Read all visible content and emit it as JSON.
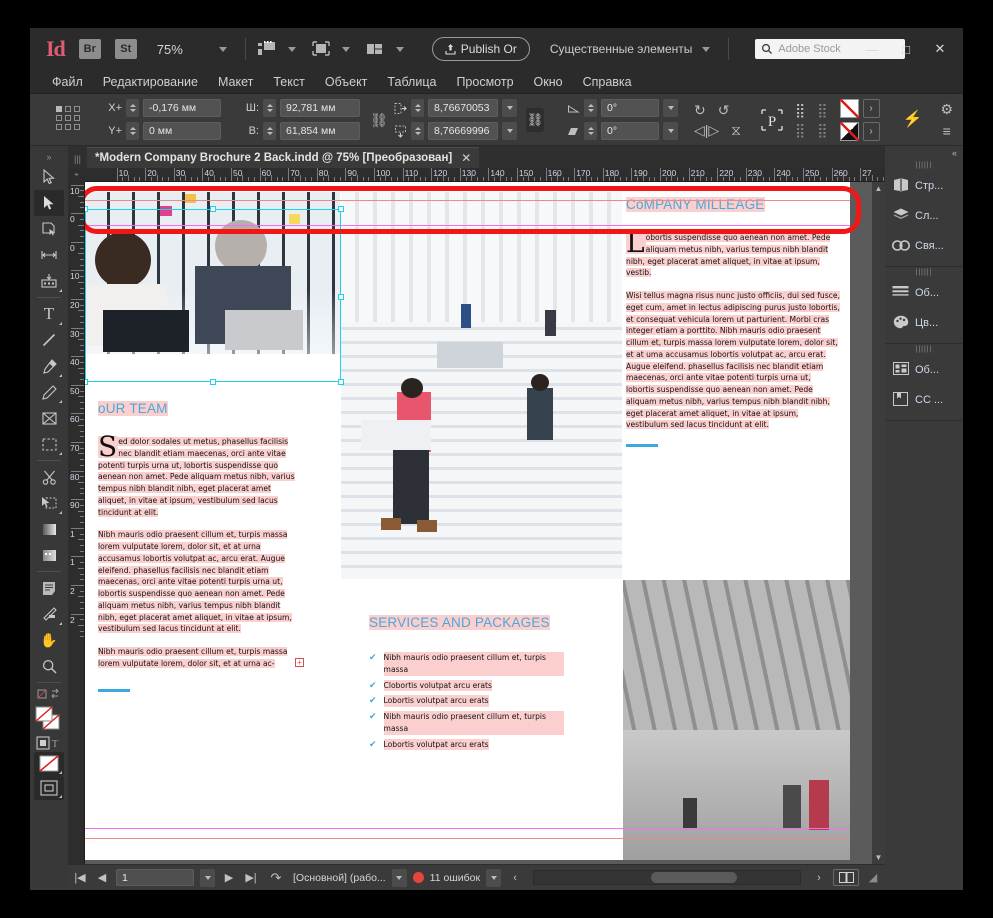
{
  "app": {
    "logo": "Id",
    "bridge_label": "Br",
    "stock_label": "St",
    "zoom_level": "75%",
    "publish_label": "Publish Or",
    "workspace": "Существенные элементы",
    "search_placeholder": "Adobe Stock",
    "win_minimize": "—",
    "win_maximize": "□",
    "win_close": "✕"
  },
  "menu": {
    "items": [
      "Файл",
      "Редактирование",
      "Макет",
      "Текст",
      "Объект",
      "Таблица",
      "Просмотр",
      "Окно",
      "Справка"
    ]
  },
  "control_panel": {
    "x_label": "X+",
    "x_value": "-0,176 мм",
    "y_label": "Y+",
    "y_value": "0 мм",
    "w_label": "Ш:",
    "w_value": "92,781 мм",
    "h_label": "В:",
    "h_value": "61,854 мм",
    "scale_x": "8,76670053",
    "scale_y": "8,76669996",
    "rotate_value": "0°",
    "shear_value": "0°"
  },
  "document": {
    "tab_title": "*Modern Company Brochure 2 Back.indd @ 75% [Преобразован]",
    "tab_close": "✕"
  },
  "rulers": {
    "h_numbers": [
      "10",
      "20",
      "30",
      "40",
      "50",
      "60",
      "70",
      "80",
      "90",
      "100",
      "110",
      "120",
      "130",
      "140",
      "150",
      "160",
      "170",
      "180",
      "190",
      "200",
      "210",
      "220",
      "230",
      "240",
      "250",
      "260",
      "27"
    ],
    "v_numbers": [
      "10",
      "0",
      "0",
      "10",
      "20",
      "30",
      "40",
      "50",
      "60",
      "70",
      "80",
      "90",
      "1",
      "1",
      "2",
      "2"
    ]
  },
  "toolbox": {
    "tools": [
      {
        "name": "selection-tool",
        "glyph": "▷"
      },
      {
        "name": "direct-selection-tool",
        "glyph": "▶"
      },
      {
        "name": "page-tool",
        "glyph": "◫"
      },
      {
        "name": "gap-tool",
        "glyph": "↔"
      },
      {
        "name": "content-collector-tool",
        "glyph": "▤"
      },
      {
        "name": "type-tool",
        "glyph": "T"
      },
      {
        "name": "line-tool",
        "glyph": "／"
      },
      {
        "name": "pen-tool",
        "glyph": "✒"
      },
      {
        "name": "pencil-tool",
        "glyph": "✎"
      },
      {
        "name": "frame-tool",
        "glyph": "⊠"
      },
      {
        "name": "rectangle-tool",
        "glyph": "▢"
      },
      {
        "name": "scissors-tool",
        "glyph": "✂"
      },
      {
        "name": "free-transform-tool",
        "glyph": "⬓"
      },
      {
        "name": "gradient-swatch-tool",
        "glyph": "▨"
      },
      {
        "name": "gradient-feather-tool",
        "glyph": "▩"
      },
      {
        "name": "note-tool",
        "glyph": "▤"
      },
      {
        "name": "eyedropper-tool",
        "glyph": "⌁"
      },
      {
        "name": "hand-tool",
        "glyph": "✋"
      },
      {
        "name": "zoom-tool",
        "glyph": "⚲"
      }
    ]
  },
  "dock": {
    "collapse_glyph": "«",
    "groups": [
      [
        {
          "icon": "pages-icon",
          "label": "Стр...",
          "glyph": "◫"
        },
        {
          "icon": "layers-icon",
          "label": "Сл...",
          "glyph": "◆"
        },
        {
          "icon": "links-icon",
          "label": "Свя...",
          "glyph": "∞"
        }
      ],
      [
        {
          "icon": "stroke-icon",
          "label": "Об...",
          "glyph": "≡"
        },
        {
          "icon": "color-icon",
          "label": "Цв...",
          "glyph": "◒"
        }
      ],
      [
        {
          "icon": "object-styles-icon",
          "label": "Об...",
          "glyph": "▦"
        },
        {
          "icon": "cc-libraries-icon",
          "label": "CC ...",
          "glyph": "❏"
        }
      ]
    ]
  },
  "statusbar": {
    "first_page": "|◀",
    "prev_page": "◀",
    "page_value": "1",
    "next_page": "▶",
    "last_page": "▶|",
    "preflight_label": "[Основной] (рабо...",
    "errors_label": "11 ошибок",
    "more_glyph": "‹",
    "expand_glyph": "›"
  },
  "brochure": {
    "company_heading": "CoMPANY MILLEAGE",
    "company_dropcap": "L",
    "company_p1": "obortis suspendisse quo aenean non amet. Pede aliquam metus nibh, varius tempus nibh blandit nibh, eget placerat amet aliquet, in vitae at ipsum, vestib.",
    "company_p2": "Wisi tellus magna risus nunc justo officiis, dui sed fusce, eget cum, amet in lectus adipiscing purus justo lobortis, et consequat vehicula lorem ut parturient. Morbi cras integer etiam a porttito. Nibh mauris odio praesent cillum et, turpis massa lorem vulputate lorem, dolor sit, et at uma accusamus lobortis volutpat ac, arcu erat. Augue eleifend. phasellus facilisis nec blandit etiam maecenas, orci ante vitae potenti turpis urna ut, lobortis suspendisse quo aenean non amet. Pede aliquam metus nibh, varius tempus nibh blandit nibh, eget placerat amet aliquet, in vitae at ipsum, vestibulum sed lacus tincidunt at elit.",
    "team_heading": "oUR TEAM",
    "team_dropcap": "S",
    "team_p1": "ed dolor sodales ut metus, phasellus facilisis nec blandit etiam maecenas, orci ante vitae potenti turpis urna ut, lobortis suspendisse quo aenean non amet. Pede aliquam metus nibh, varius tempus nibh blandit nibh, eget placerat amet aliquet, in vitae at ipsum, vestibulum sed lacus tincidunt at elit.",
    "team_p2": "Nibh mauris odio praesent cillum et, turpis massa lorem vulputate lorem, dolor sit, et at urna accusamus lobortis volutpat ac, arcu erat. Augue eleifend. phasellus facilisis nec blandit etiam maecenas, orci ante vitae potenti turpis urna ut, lobortis suspendisse quo aenean non amet. Pede aliquam metus nibh, varius tempus nibh blandit nibh, eget placerat amet aliquet, in vitae at ipsum, vestibulum sed lacus tincidunt at elit.",
    "team_p3": "Nibh mauris odio praesent cillum et, turpis massa lorem vulputate lorem, dolor sit, et at urna ac-",
    "services_heading": "SERVICES AND PACKAGES",
    "services_items": [
      "Nibh mauris odio praesent cillum et, turpis massa",
      "Clobortis volutpat arcu erats",
      "Lobortis volutpat arcu erats",
      "Nibh mauris odio praesent cillum et, turpis massa",
      "Lobortis volutpat arcu erats"
    ],
    "check_glyph": "✔",
    "overflow_glyph": "+"
  },
  "colors": {
    "accent_blue": "#49a9dc",
    "highlight_pink": "#fbcfce",
    "annotation_red": "#f21616",
    "selection_cyan": "#19d3e8",
    "error_red": "#e8443a"
  }
}
